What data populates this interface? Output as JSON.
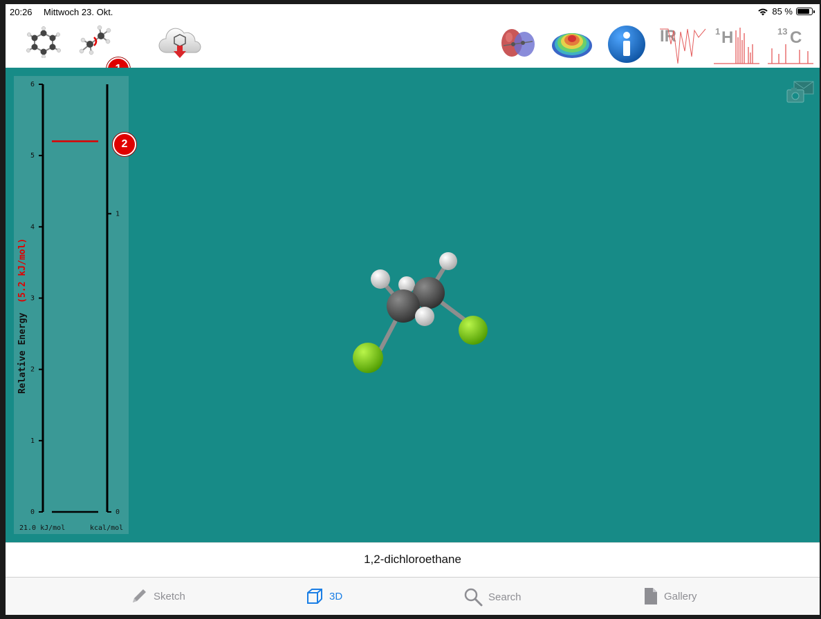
{
  "status": {
    "time": "20:26",
    "date": "Mittwoch 23. Okt.",
    "battery_text": "85 %",
    "battery_level": 0.85
  },
  "toolbar": {
    "badge1": "1",
    "badge2": "2",
    "ir_label": "IR",
    "h_label_super": "1",
    "h_label": "H",
    "c_label_super": "13",
    "c_label": "C"
  },
  "energy": {
    "axis_title": "Relative Energy",
    "axis_value": "(5.2 kJ/mol)",
    "value_kj": 5.2,
    "kj_ticks": [
      "6",
      "5",
      "4",
      "3",
      "2",
      "1",
      "0"
    ],
    "kcal_ticks": [
      "1",
      "0"
    ],
    "kj_unit": "21.0 kJ/mol",
    "kcal_unit": "kcal/mol"
  },
  "molecule": {
    "name": "1,2-dichloroethane"
  },
  "tabs": [
    {
      "label": "Sketch",
      "icon": "pencil-icon",
      "active": false
    },
    {
      "label": "3D",
      "icon": "cube-icon",
      "active": true
    },
    {
      "label": "Search",
      "icon": "magnifier-icon",
      "active": false
    },
    {
      "label": "Gallery",
      "icon": "document-icon",
      "active": false
    }
  ],
  "colors": {
    "viewer_bg": "#178b87",
    "panel_bg": "#3a9996",
    "energy_line": "#e00000",
    "chlorine": "#6cc700",
    "carbon": "#4a4a4a",
    "hydrogen": "#e8e8e8",
    "tab_active": "#1a7ee5"
  }
}
